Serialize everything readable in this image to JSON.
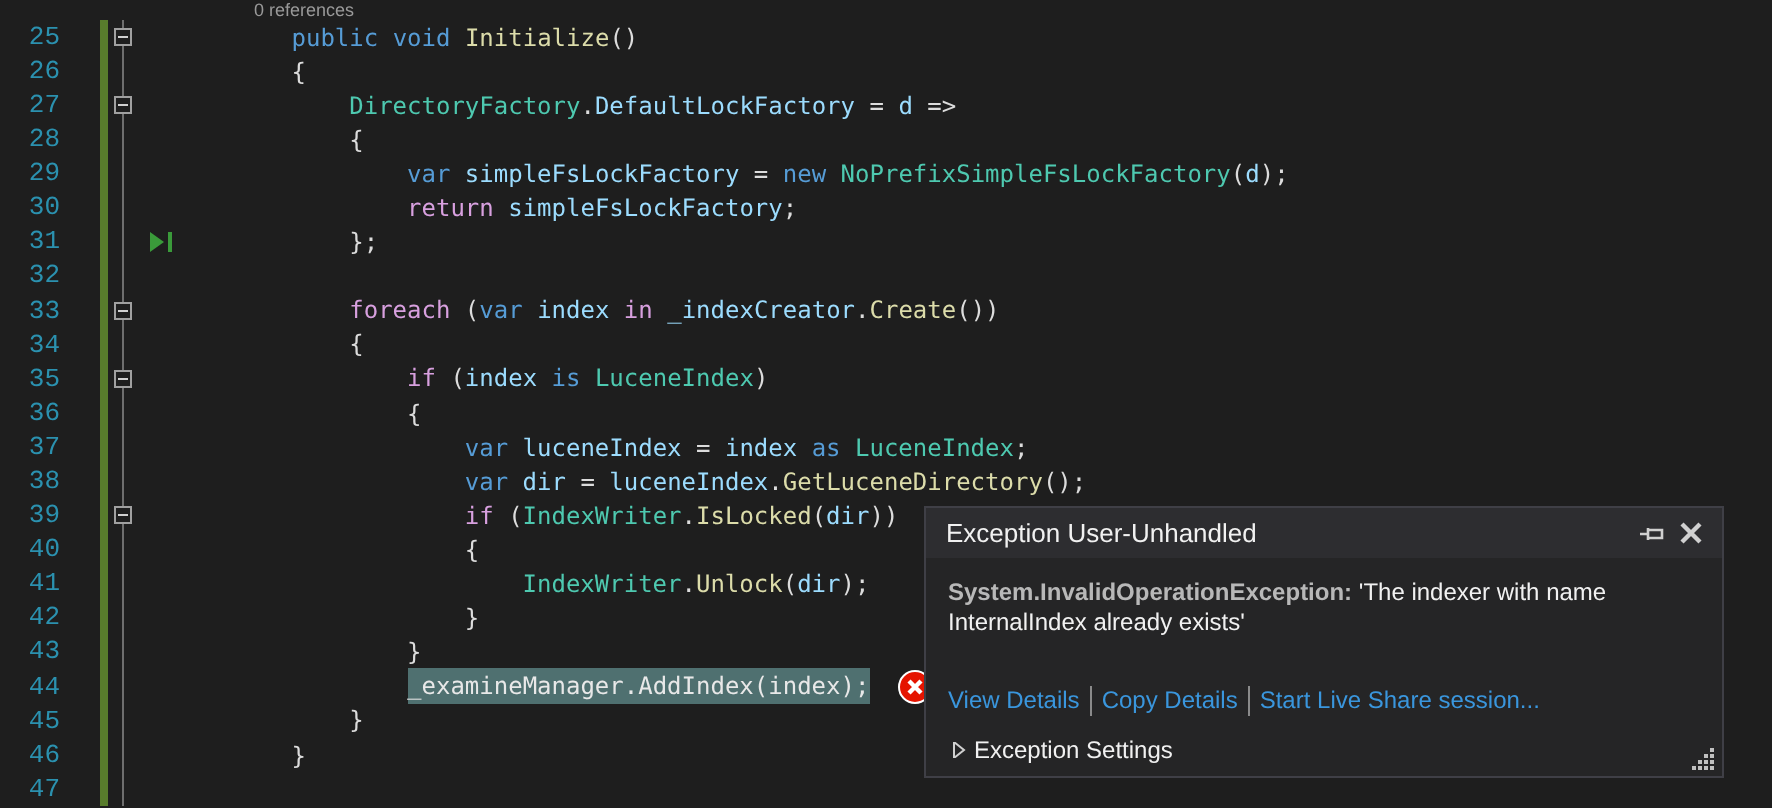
{
  "codelens": "0 references",
  "lines": [
    {
      "number": "25",
      "kind": "code",
      "foldable": true,
      "tokens": [
        {
          "kind": "kw",
          "text": "public void "
        },
        {
          "kind": "method",
          "text": "Initialize"
        },
        {
          "kind": "plain",
          "text": "()"
        }
      ]
    },
    {
      "number": "26",
      "kind": "open",
      "foldable": false,
      "tokens": [
        {
          "kind": "plain",
          "text": "{"
        }
      ]
    },
    {
      "number": "27",
      "kind": "code",
      "foldable": true,
      "tokens": [
        {
          "kind": "type",
          "text": "DirectoryFactory"
        },
        {
          "kind": "plain",
          "text": "."
        },
        {
          "kind": "var",
          "text": "DefaultLockFactory"
        },
        {
          "kind": "plain",
          "text": " = "
        },
        {
          "kind": "var",
          "text": "d"
        },
        {
          "kind": "plain",
          "text": " =>"
        }
      ]
    },
    {
      "number": "28",
      "kind": "open",
      "foldable": false,
      "tokens": [
        {
          "kind": "plain",
          "text": "{"
        }
      ]
    },
    {
      "number": "29",
      "kind": "code",
      "foldable": false,
      "tokens": [
        {
          "kind": "kw",
          "text": "var "
        },
        {
          "kind": "var",
          "text": "simpleFsLockFactory"
        },
        {
          "kind": "plain",
          "text": " = "
        },
        {
          "kind": "kw",
          "text": "new "
        },
        {
          "kind": "type",
          "text": "NoPrefixSimpleFsLockFactory"
        },
        {
          "kind": "plain",
          "text": "("
        },
        {
          "kind": "var",
          "text": "d"
        },
        {
          "kind": "plain",
          "text": ");"
        }
      ]
    },
    {
      "number": "30",
      "kind": "code",
      "foldable": false,
      "tokens": [
        {
          "kind": "ctrl",
          "text": "return "
        },
        {
          "kind": "var",
          "text": "simpleFsLockFactory"
        },
        {
          "kind": "plain",
          "text": ";"
        }
      ]
    },
    {
      "number": "31",
      "kind": "close",
      "foldable": false,
      "run_marker": true,
      "tokens": [
        {
          "kind": "plain",
          "text": "};"
        }
      ]
    },
    {
      "number": "32",
      "kind": "code",
      "foldable": false
    },
    {
      "number": "33",
      "kind": "code",
      "foldable": true,
      "tokens": [
        {
          "kind": "ctrl",
          "text": "foreach"
        },
        {
          "kind": "plain",
          "text": " ("
        },
        {
          "kind": "kw",
          "text": "var "
        },
        {
          "kind": "var",
          "text": "index"
        },
        {
          "kind": "ctrl",
          "text": " in "
        },
        {
          "kind": "var",
          "text": "_indexCreator"
        },
        {
          "kind": "plain",
          "text": "."
        },
        {
          "kind": "method",
          "text": "Create"
        },
        {
          "kind": "plain",
          "text": "())"
        }
      ]
    },
    {
      "number": "34",
      "kind": "open",
      "foldable": false,
      "tokens": [
        {
          "kind": "plain",
          "text": "{"
        }
      ]
    },
    {
      "number": "35",
      "kind": "code",
      "foldable": true,
      "tokens": [
        {
          "kind": "ctrl",
          "text": "if"
        },
        {
          "kind": "plain",
          "text": " ("
        },
        {
          "kind": "var",
          "text": "index"
        },
        {
          "kind": "kw",
          "text": " is "
        },
        {
          "kind": "type",
          "text": "LuceneIndex"
        },
        {
          "kind": "plain",
          "text": ")"
        }
      ]
    },
    {
      "number": "36",
      "kind": "open",
      "foldable": false,
      "tokens": [
        {
          "kind": "plain",
          "text": "{"
        }
      ]
    },
    {
      "number": "37",
      "kind": "code",
      "foldable": false,
      "tokens": [
        {
          "kind": "kw",
          "text": "var "
        },
        {
          "kind": "var",
          "text": "luceneIndex"
        },
        {
          "kind": "plain",
          "text": " = "
        },
        {
          "kind": "var",
          "text": "index"
        },
        {
          "kind": "kw",
          "text": " as "
        },
        {
          "kind": "type",
          "text": "LuceneIndex"
        },
        {
          "kind": "plain",
          "text": ";"
        }
      ]
    },
    {
      "number": "38",
      "kind": "code",
      "foldable": false,
      "tokens": [
        {
          "kind": "kw",
          "text": "var "
        },
        {
          "kind": "var",
          "text": "dir"
        },
        {
          "kind": "plain",
          "text": " = "
        },
        {
          "kind": "var",
          "text": "luceneIndex"
        },
        {
          "kind": "plain",
          "text": "."
        },
        {
          "kind": "method",
          "text": "GetLuceneDirectory"
        },
        {
          "kind": "plain",
          "text": "();"
        }
      ]
    },
    {
      "number": "39",
      "kind": "code",
      "foldable": true,
      "tokens": [
        {
          "kind": "ctrl",
          "text": "if"
        },
        {
          "kind": "plain",
          "text": " ("
        },
        {
          "kind": "type",
          "text": "IndexWriter"
        },
        {
          "kind": "plain",
          "text": "."
        },
        {
          "kind": "method",
          "text": "IsLocked"
        },
        {
          "kind": "plain",
          "text": "("
        },
        {
          "kind": "var",
          "text": "dir"
        },
        {
          "kind": "plain",
          "text": "))"
        }
      ]
    },
    {
      "number": "40",
      "kind": "open",
      "foldable": false,
      "tokens": [
        {
          "kind": "plain",
          "text": "{"
        }
      ]
    },
    {
      "number": "41",
      "kind": "code",
      "foldable": false,
      "tokens": [
        {
          "kind": "type",
          "text": "IndexWriter"
        },
        {
          "kind": "plain",
          "text": "."
        },
        {
          "kind": "method",
          "text": "Unlock"
        },
        {
          "kind": "plain",
          "text": "("
        },
        {
          "kind": "var",
          "text": "dir"
        },
        {
          "kind": "plain",
          "text": ");"
        }
      ]
    },
    {
      "number": "42",
      "kind": "close",
      "foldable": false,
      "tokens": [
        {
          "kind": "plain",
          "text": "}"
        }
      ]
    },
    {
      "number": "43",
      "kind": "close",
      "foldable": false,
      "tokens": [
        {
          "kind": "plain",
          "text": "}"
        }
      ]
    },
    {
      "number": "44",
      "kind": "code",
      "foldable": false,
      "current": true,
      "error": true,
      "tokens": [
        {
          "kind": "plain",
          "text": "_examineManager.AddIndex(index);"
        }
      ]
    },
    {
      "number": "45",
      "kind": "close",
      "foldable": false,
      "tokens": [
        {
          "kind": "plain",
          "text": "}"
        }
      ]
    },
    {
      "number": "46",
      "kind": "close",
      "foldable": false,
      "tokens": [
        {
          "kind": "plain",
          "text": "}"
        }
      ]
    },
    {
      "number": "47",
      "kind": "code",
      "foldable": false
    }
  ],
  "exception_popup": {
    "title": "Exception User-Unhandled",
    "message": "**System.InvalidOperationException:** 'The indexer with name InternalIndex already exists'",
    "links": [
      "View Details",
      "Copy Details",
      "Start Live Share session..."
    ],
    "settings": {
      "label": "Exception Settings",
      "expanded": false
    }
  }
}
